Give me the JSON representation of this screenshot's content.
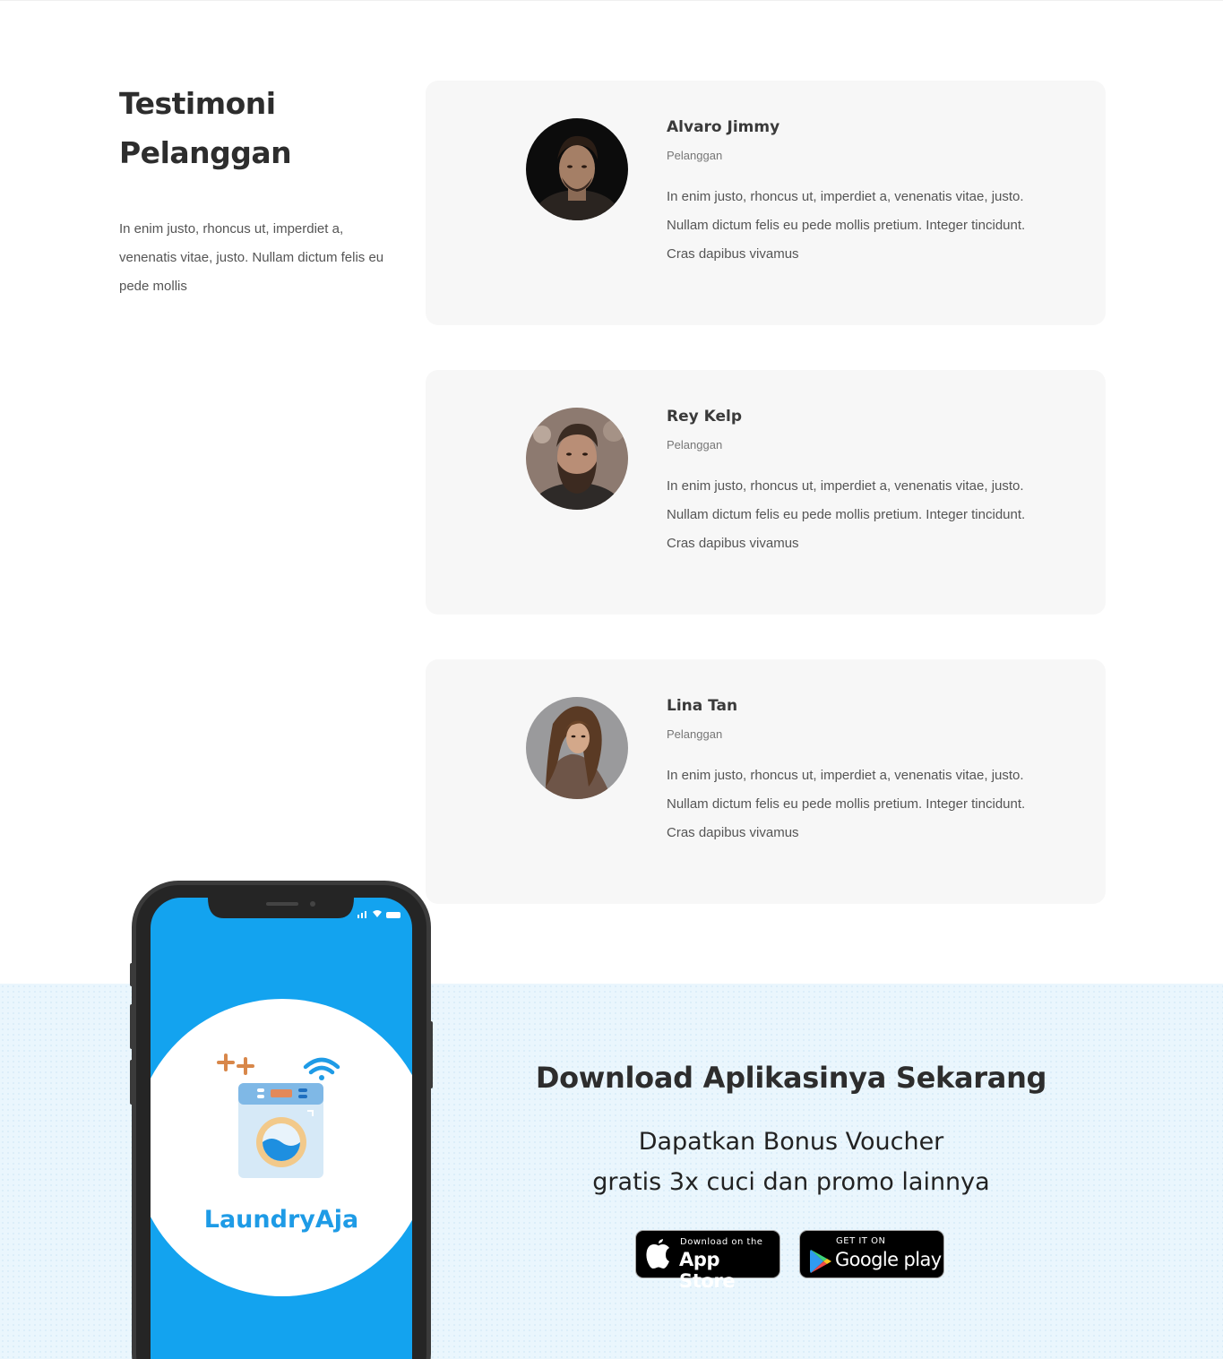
{
  "testimonials_section": {
    "title_line1": "Testimoni",
    "title_line2": "Pelanggan",
    "description": "In enim justo, rhoncus ut, imperdiet a, venenatis vitae, justo. Nullam dictum felis eu pede mollis"
  },
  "testimonials": [
    {
      "name": "Alvaro Jimmy",
      "role": "Pelanggan",
      "quote": "In enim justo, rhoncus ut, imperdiet a, venenatis vitae, justo. Nullam dictum felis eu pede mollis pretium. Integer tincidunt. Cras dapibus vivamus"
    },
    {
      "name": "Rey Kelp",
      "role": "Pelanggan",
      "quote": "In enim justo, rhoncus ut, imperdiet a, venenatis vitae, justo. Nullam dictum felis eu pede mollis pretium. Integer tincidunt. Cras dapibus vivamus"
    },
    {
      "name": "Lina Tan",
      "role": "Pelanggan",
      "quote": "In enim justo, rhoncus ut, imperdiet a, venenatis vitae, justo. Nullam dictum felis eu pede mollis pretium. Integer tincidunt. Cras dapibus vivamus"
    }
  ],
  "download": {
    "title": "Download Aplikasinya Sekarang",
    "subtitle_line1": "Dapatkan Bonus Voucher",
    "subtitle_line2": "gratis 3x cuci dan promo lainnya",
    "app_store": {
      "small": "Download on the",
      "big": "App Store",
      "icon": "apple-icon"
    },
    "google_play": {
      "small": "GET IT ON",
      "big": "Google play",
      "icon": "google-play-icon"
    }
  },
  "phone_app": {
    "logo_text": "LaundryAja",
    "brand_color": "#13a3ef"
  },
  "colors": {
    "card_bg": "#f7f7f7",
    "band_bg": "#eaf6fd",
    "heading": "#2d2d2d"
  }
}
